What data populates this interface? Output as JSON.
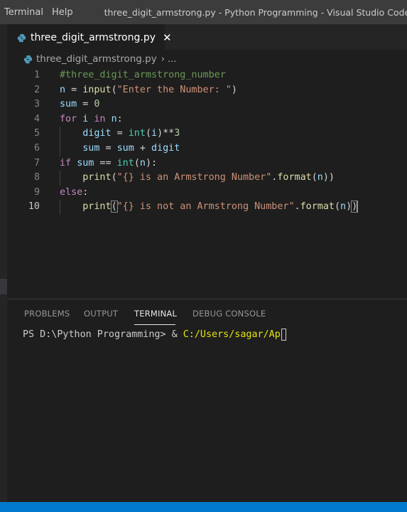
{
  "menu": {
    "items": [
      "Terminal",
      "Help"
    ]
  },
  "window": {
    "title": "three_digit_armstrong.py - Python Programming - Visual Studio Code"
  },
  "tab": {
    "label": "three_digit_armstrong.py",
    "close": "✕",
    "icon": "python-icon"
  },
  "breadcrumb": {
    "file": "three_digit_armstrong.py",
    "separator": "›",
    "more": "..."
  },
  "editor": {
    "active_line": 10,
    "lines": [
      {
        "n": "1",
        "tokens": [
          [
            "cm",
            "#three_digit_armstrong_number"
          ]
        ]
      },
      {
        "n": "2",
        "tokens": [
          [
            "id",
            "n"
          ],
          [
            "op",
            " = "
          ],
          [
            "fn",
            "input"
          ],
          [
            "op",
            "("
          ],
          [
            "st",
            "\"Enter the Number: \""
          ],
          [
            "op",
            ")"
          ]
        ]
      },
      {
        "n": "3",
        "tokens": [
          [
            "id",
            "sum"
          ],
          [
            "op",
            " = "
          ],
          [
            "nm",
            "0"
          ]
        ]
      },
      {
        "n": "4",
        "tokens": [
          [
            "kw",
            "for"
          ],
          [
            "op",
            " "
          ],
          [
            "id",
            "i"
          ],
          [
            "op",
            " "
          ],
          [
            "kw",
            "in"
          ],
          [
            "op",
            " "
          ],
          [
            "id",
            "n"
          ],
          [
            "op",
            ":"
          ]
        ]
      },
      {
        "n": "5",
        "tokens": [
          [
            "op",
            "    "
          ],
          [
            "id",
            "digit"
          ],
          [
            "op",
            " = "
          ],
          [
            "cl",
            "int"
          ],
          [
            "op",
            "("
          ],
          [
            "id",
            "i"
          ],
          [
            "op",
            ")**"
          ],
          [
            "nm",
            "3"
          ]
        ]
      },
      {
        "n": "6",
        "tokens": [
          [
            "op",
            "    "
          ],
          [
            "id",
            "sum"
          ],
          [
            "op",
            " = "
          ],
          [
            "id",
            "sum"
          ],
          [
            "op",
            " + "
          ],
          [
            "id",
            "digit"
          ]
        ]
      },
      {
        "n": "7",
        "tokens": [
          [
            "kw",
            "if"
          ],
          [
            "op",
            " "
          ],
          [
            "id",
            "sum"
          ],
          [
            "op",
            " == "
          ],
          [
            "cl",
            "int"
          ],
          [
            "op",
            "("
          ],
          [
            "id",
            "n"
          ],
          [
            "op",
            "):"
          ]
        ]
      },
      {
        "n": "8",
        "tokens": [
          [
            "op",
            "    "
          ],
          [
            "fn",
            "print"
          ],
          [
            "op",
            "("
          ],
          [
            "st",
            "\"{} is an Armstrong Number\""
          ],
          [
            "op",
            "."
          ],
          [
            "fn",
            "format"
          ],
          [
            "op",
            "("
          ],
          [
            "id",
            "n"
          ],
          [
            "op",
            "))"
          ]
        ]
      },
      {
        "n": "9",
        "tokens": [
          [
            "kw",
            "else"
          ],
          [
            "op",
            ":"
          ]
        ]
      },
      {
        "n": "10",
        "tokens": [
          [
            "op",
            "    "
          ],
          [
            "fn",
            "print"
          ],
          [
            "op",
            "("
          ],
          [
            "st",
            "\"{} is not an Armstrong Number\""
          ],
          [
            "op",
            "."
          ],
          [
            "fn",
            "format"
          ],
          [
            "op",
            "("
          ],
          [
            "id",
            "n"
          ],
          [
            "op",
            ")"
          ],
          [
            "op",
            ")"
          ]
        ]
      }
    ]
  },
  "panel": {
    "tabs": [
      {
        "label": "PROBLEMS",
        "active": false
      },
      {
        "label": "OUTPUT",
        "active": false
      },
      {
        "label": "TERMINAL",
        "active": true
      },
      {
        "label": "DEBUG CONSOLE",
        "active": false
      }
    ],
    "terminal": {
      "prompt": "PS D:\\Python Programming> & ",
      "command_path": "C:/Users/sagar/Ap"
    }
  },
  "colors": {
    "status_bar": "#007acc",
    "editor_bg": "#1e1e1e",
    "title_bar": "#3c3c3c"
  }
}
